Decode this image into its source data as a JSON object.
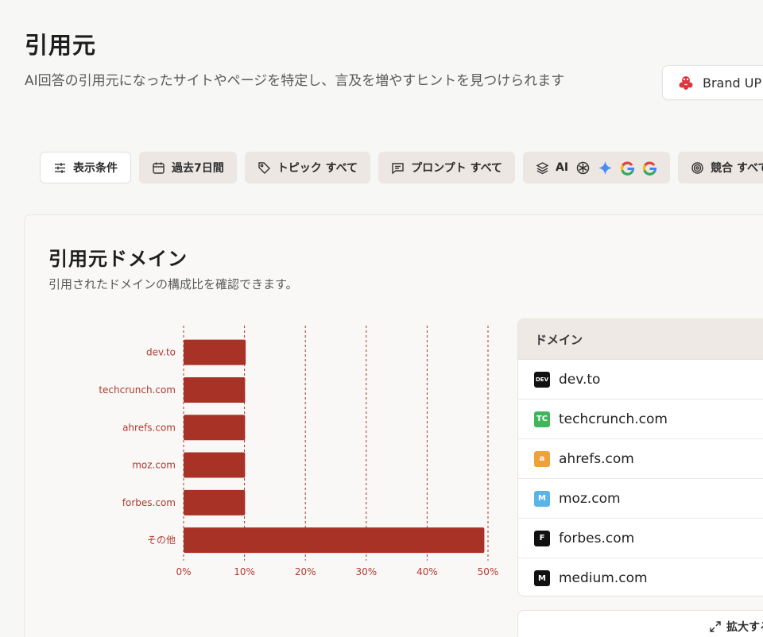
{
  "header": {
    "title": "引用元",
    "description": "AI回答の引用元になったサイトやページを特定し、言及を増やすヒントを見つけられます",
    "brand_button_label": "Brand UP"
  },
  "filters": {
    "display_conditions": "表示条件",
    "period": "過去7日間",
    "topic": "トピック すべて",
    "prompt": "プロンプト すべて",
    "ai": "AI",
    "competitors": "競合 すべて"
  },
  "card": {
    "title": "引用元ドメイン",
    "description": "引用されたドメインの構成比を確認できます。"
  },
  "chart_data": {
    "type": "bar",
    "orientation": "horizontal",
    "categories": [
      "dev.to",
      "techcrunch.com",
      "ahrefs.com",
      "moz.com",
      "forbes.com",
      "その他"
    ],
    "values": [
      10.2,
      10.1,
      10.1,
      10.1,
      10.1,
      49.4
    ],
    "x_ticks": [
      "0%",
      "10%",
      "20%",
      "30%",
      "40%",
      "50%"
    ],
    "xlim": [
      0,
      50
    ],
    "grid": "vertical dashed",
    "bar_color": "#a93226",
    "label_color": "#b03a2e"
  },
  "table": {
    "header": "ドメイン",
    "rows": [
      {
        "domain": "dev.to",
        "icon": "DEV",
        "icon_color": "#111111"
      },
      {
        "domain": "techcrunch.com",
        "icon": "TC",
        "icon_color": "#3fb65b"
      },
      {
        "domain": "ahrefs.com",
        "icon": "a",
        "icon_color": "#f0a23a"
      },
      {
        "domain": "moz.com",
        "icon": "M",
        "icon_color": "#5ab4e5"
      },
      {
        "domain": "forbes.com",
        "icon": "F",
        "icon_color": "#111111"
      },
      {
        "domain": "medium.com",
        "icon": "M",
        "icon_color": "#111111"
      }
    ]
  },
  "expand": {
    "label": "拡大する"
  }
}
